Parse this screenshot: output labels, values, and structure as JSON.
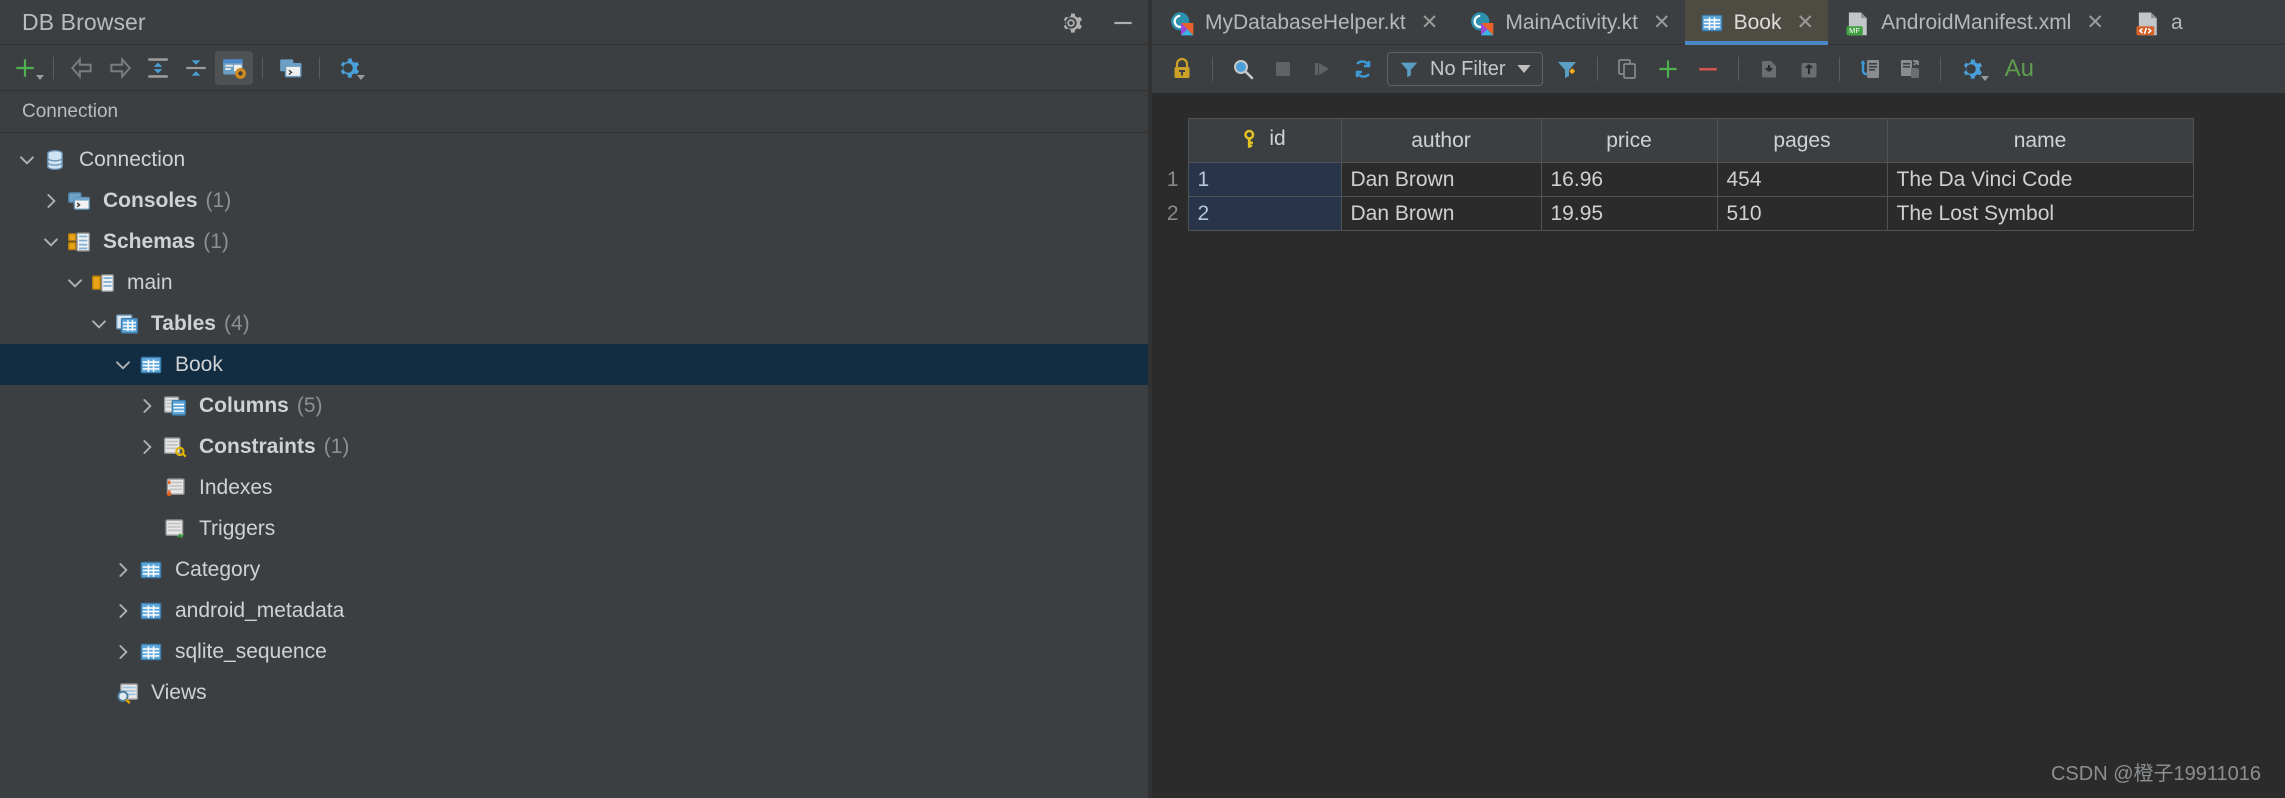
{
  "db_browser": {
    "title": "DB Browser",
    "title_actions": [
      {
        "name": "settings-icon",
        "label": "Settings"
      },
      {
        "name": "minimize-icon",
        "label": "Hide"
      }
    ],
    "toolbar": [
      {
        "name": "add-icon",
        "label": "New",
        "active": false
      },
      {
        "name": "sep",
        "label": ""
      },
      {
        "name": "back-arrow-icon",
        "label": "Back",
        "active": false
      },
      {
        "name": "forward-arrow-icon",
        "label": "Forward",
        "active": false
      },
      {
        "name": "expand-all-icon",
        "label": "Expand All",
        "active": false
      },
      {
        "name": "collapse-all-icon",
        "label": "Collapse All",
        "active": false
      },
      {
        "name": "jump-to-editor-icon",
        "label": "Jump to Query Console",
        "active": true
      },
      {
        "name": "sep",
        "label": ""
      },
      {
        "name": "open-console-icon",
        "label": "Open Console",
        "active": false
      },
      {
        "name": "sep",
        "label": ""
      },
      {
        "name": "gear-icon",
        "label": "Options",
        "active": false
      }
    ],
    "tab_label": "Connection",
    "tree": [
      {
        "label": "Connection",
        "count": "",
        "bold": false,
        "indent": 0,
        "arrow": "down",
        "icon": "database-icon",
        "selected": false
      },
      {
        "label": "Consoles",
        "count": "(1)",
        "bold": true,
        "indent": 1,
        "arrow": "right",
        "icon": "console-folder-icon",
        "selected": false
      },
      {
        "label": "Schemas",
        "count": "(1)",
        "bold": true,
        "indent": 1,
        "arrow": "down",
        "icon": "schema-folder-icon",
        "selected": false
      },
      {
        "label": "main",
        "count": "",
        "bold": false,
        "indent": 2,
        "arrow": "down",
        "icon": "schema-icon",
        "selected": false
      },
      {
        "label": "Tables",
        "count": "(4)",
        "bold": true,
        "indent": 3,
        "arrow": "down",
        "icon": "tables-folder-icon",
        "selected": false
      },
      {
        "label": "Book",
        "count": "",
        "bold": false,
        "indent": 4,
        "arrow": "down",
        "icon": "table-icon",
        "selected": true
      },
      {
        "label": "Columns",
        "count": "(5)",
        "bold": true,
        "indent": 5,
        "arrow": "right",
        "icon": "columns-folder-icon",
        "selected": false
      },
      {
        "label": "Constraints",
        "count": "(1)",
        "bold": true,
        "indent": 5,
        "arrow": "right",
        "icon": "constraints-folder-icon",
        "selected": false
      },
      {
        "label": "Indexes",
        "count": "",
        "bold": false,
        "indent": 5,
        "arrow": "none",
        "icon": "indexes-icon",
        "selected": false
      },
      {
        "label": "Triggers",
        "count": "",
        "bold": false,
        "indent": 5,
        "arrow": "none",
        "icon": "triggers-icon",
        "selected": false
      },
      {
        "label": "Category",
        "count": "",
        "bold": false,
        "indent": 4,
        "arrow": "right",
        "icon": "table-icon",
        "selected": false
      },
      {
        "label": "android_metadata",
        "count": "",
        "bold": false,
        "indent": 4,
        "arrow": "right",
        "icon": "table-icon",
        "selected": false
      },
      {
        "label": "sqlite_sequence",
        "count": "",
        "bold": false,
        "indent": 4,
        "arrow": "right",
        "icon": "table-icon",
        "selected": false
      },
      {
        "label": "Views",
        "count": "",
        "bold": false,
        "indent": 3,
        "arrow": "none",
        "icon": "views-icon",
        "selected": false
      }
    ]
  },
  "editor": {
    "tabs": [
      {
        "label": "MyDatabaseHelper.kt",
        "icon": "kotlin-file-icon",
        "active": false,
        "closable": true
      },
      {
        "label": "MainActivity.kt",
        "icon": "kotlin-file-icon",
        "active": false,
        "closable": true
      },
      {
        "label": "Book",
        "icon": "table-icon",
        "active": true,
        "closable": true
      },
      {
        "label": "AndroidManifest.xml",
        "icon": "manifest-file-icon",
        "active": false,
        "closable": true
      },
      {
        "label": "a",
        "icon": "xml-file-icon",
        "active": false,
        "closable": false
      }
    ],
    "toolbar": {
      "items": [
        {
          "name": "lock-icon",
          "label": "Toggle Read-Only"
        },
        {
          "name": "sep",
          "label": ""
        },
        {
          "name": "search-icon",
          "label": "Find"
        },
        {
          "name": "stop-icon",
          "label": "Cancel"
        },
        {
          "name": "run-icon",
          "label": "Execute"
        },
        {
          "name": "refresh-icon",
          "label": "Reload Page"
        },
        {
          "name": "filter-dropdown",
          "label": "No Filter"
        },
        {
          "name": "clear-filter-icon",
          "label": "Clear Filter"
        },
        {
          "name": "sep",
          "label": ""
        },
        {
          "name": "copy-row-icon",
          "label": "Duplicate Row"
        },
        {
          "name": "add-row-icon",
          "label": "Add New Row"
        },
        {
          "name": "delete-row-icon",
          "label": "Delete Row"
        },
        {
          "name": "sep",
          "label": ""
        },
        {
          "name": "revert-icon",
          "label": "Revert Selected"
        },
        {
          "name": "submit-icon",
          "label": "Submit"
        },
        {
          "name": "sep",
          "label": ""
        },
        {
          "name": "import-data-icon",
          "label": "Import Data"
        },
        {
          "name": "export-data-icon",
          "label": "Export Data"
        },
        {
          "name": "sep",
          "label": ""
        },
        {
          "name": "gear-icon",
          "label": "Data Extractor Settings"
        }
      ],
      "filter_label": "No Filter"
    },
    "status_text": "Au"
  },
  "grid": {
    "columns": [
      {
        "label": "id",
        "key_icon": true
      },
      {
        "label": "author",
        "key_icon": false
      },
      {
        "label": "price",
        "key_icon": false
      },
      {
        "label": "pages",
        "key_icon": false
      },
      {
        "label": "name",
        "key_icon": false
      }
    ],
    "rows": [
      {
        "num": "1",
        "id": "1",
        "author": "Dan Brown",
        "price": "16.96",
        "pages": "454",
        "name": "The Da Vinci Code"
      },
      {
        "num": "2",
        "id": "2",
        "author": "Dan Brown",
        "price": "19.95",
        "pages": "510",
        "name": "The Lost Symbol"
      }
    ]
  },
  "watermark": "CSDN @橙子19911016",
  "colors": {
    "panel_bg": "#3c3f41",
    "editor_bg": "#2b2b2b",
    "selection": "#122c42",
    "active_tab": "#4e4b42",
    "accent_blue": "#4a88c7",
    "green": "#5f9d4e",
    "red": "#c75450",
    "orange": "#cc7832"
  }
}
